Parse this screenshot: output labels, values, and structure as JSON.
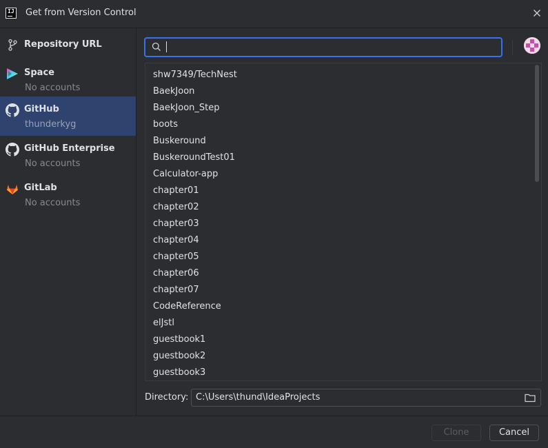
{
  "window": {
    "title": "Get from Version Control"
  },
  "sidebar": {
    "items": [
      {
        "label": "Repository URL",
        "sub": "",
        "icon": "vcs-branch-icon",
        "selected": false
      },
      {
        "label": "Space",
        "sub": "No accounts",
        "icon": "space-logo-icon",
        "selected": false
      },
      {
        "label": "GitHub",
        "sub": "thunderkyg",
        "icon": "github-icon",
        "selected": true
      },
      {
        "label": "GitHub Enterprise",
        "sub": "No accounts",
        "icon": "github-icon",
        "selected": false
      },
      {
        "label": "GitLab",
        "sub": "No accounts",
        "icon": "gitlab-icon",
        "selected": false
      }
    ]
  },
  "search": {
    "value": "",
    "placeholder": ""
  },
  "repositories": [
    "shw7349/TechNest",
    "BaekJoon",
    "BaekJoon_Step",
    "boots",
    "Buskeround",
    "BuskeroundTest01",
    "Calculator-app",
    "chapter01",
    "chapter02",
    "chapter03",
    "chapter04",
    "chapter05",
    "chapter06",
    "chapter07",
    "CodeReference",
    "elJstl",
    "guestbook1",
    "guestbook2",
    "guestbook3"
  ],
  "directory": {
    "label": "Directory:",
    "value": "C:\\Users\\thund\\IdeaProjects"
  },
  "buttons": {
    "clone": "Clone",
    "cancel": "Cancel"
  },
  "colors": {
    "accent": "#3574f0",
    "selected": "#2e436e",
    "background": "#2b2d30"
  }
}
